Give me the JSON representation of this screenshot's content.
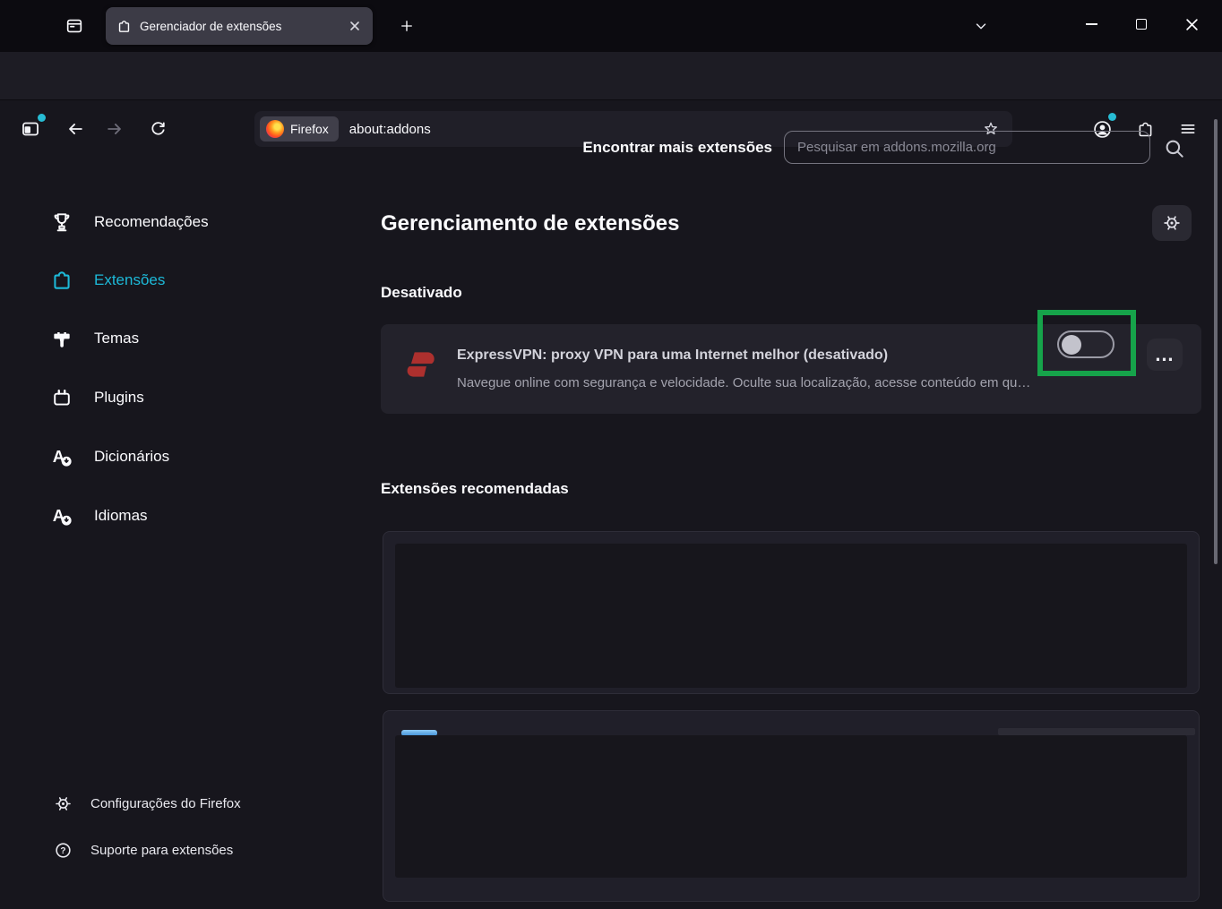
{
  "window": {
    "tab_title": "Gerenciador de extensões",
    "url_chip": "Firefox",
    "url": "about:addons"
  },
  "search": {
    "label": "Encontrar mais extensões",
    "placeholder": "Pesquisar em addons.mozilla.org"
  },
  "sidebar": {
    "items": [
      {
        "label": "Recomendações",
        "icon": "trophy-icon",
        "selected": false
      },
      {
        "label": "Extensões",
        "icon": "puzzle-icon",
        "selected": true
      },
      {
        "label": "Temas",
        "icon": "paintbrush-icon",
        "selected": false
      },
      {
        "label": "Plugins",
        "icon": "plug-icon",
        "selected": false
      },
      {
        "label": "Dicionários",
        "icon": "dictionary-download-icon",
        "selected": false
      },
      {
        "label": "Idiomas",
        "icon": "language-download-icon",
        "selected": false
      }
    ],
    "footer_items": [
      {
        "label": "Configurações do Firefox",
        "icon": "gear-icon"
      },
      {
        "label": "Suporte para extensões",
        "icon": "help-icon"
      }
    ]
  },
  "main": {
    "title": "Gerenciamento de extensões",
    "disabled_section_header": "Desativado",
    "recommended_section_header": "Extensões recomendadas",
    "extension": {
      "name": "ExpressVPN: proxy VPN para uma Internet melhor (desativado)",
      "description": "Navegue online com segurança e velocidade. Oculte sua localização, acesse conteúdo em qu…",
      "toggle_state": "off",
      "more_options_label": "…"
    }
  },
  "colors": {
    "accent_cyan": "#1db9d8",
    "annotation_green": "#16a34a",
    "expressvpn_red": "#ad302e"
  },
  "icons": {
    "search-icon": "magnifier",
    "gear-icon": "cog",
    "help-icon": "question-circle",
    "trophy-icon": "trophy",
    "puzzle-icon": "puzzle-piece",
    "paintbrush-icon": "paintbrush",
    "plug-icon": "plug-socket",
    "dictionary-download-icon": "letter-A-with-download-badge",
    "language-download-icon": "letter-A-with-download-badge",
    "star-icon": "star-outline",
    "account-icon": "person-in-circle",
    "menu-icon": "hamburger",
    "back-icon": "arrow-left",
    "forward-icon": "arrow-right",
    "reload-icon": "refresh-circle",
    "close-icon": "x",
    "chevron-down-icon": "v",
    "firefox-view-icon": "window-with-tab",
    "firefox-logo-icon": "firefox-sphere",
    "expressvpn-logo-icon": "red-diagonal-bands",
    "more-options-icon": "ellipsis"
  }
}
